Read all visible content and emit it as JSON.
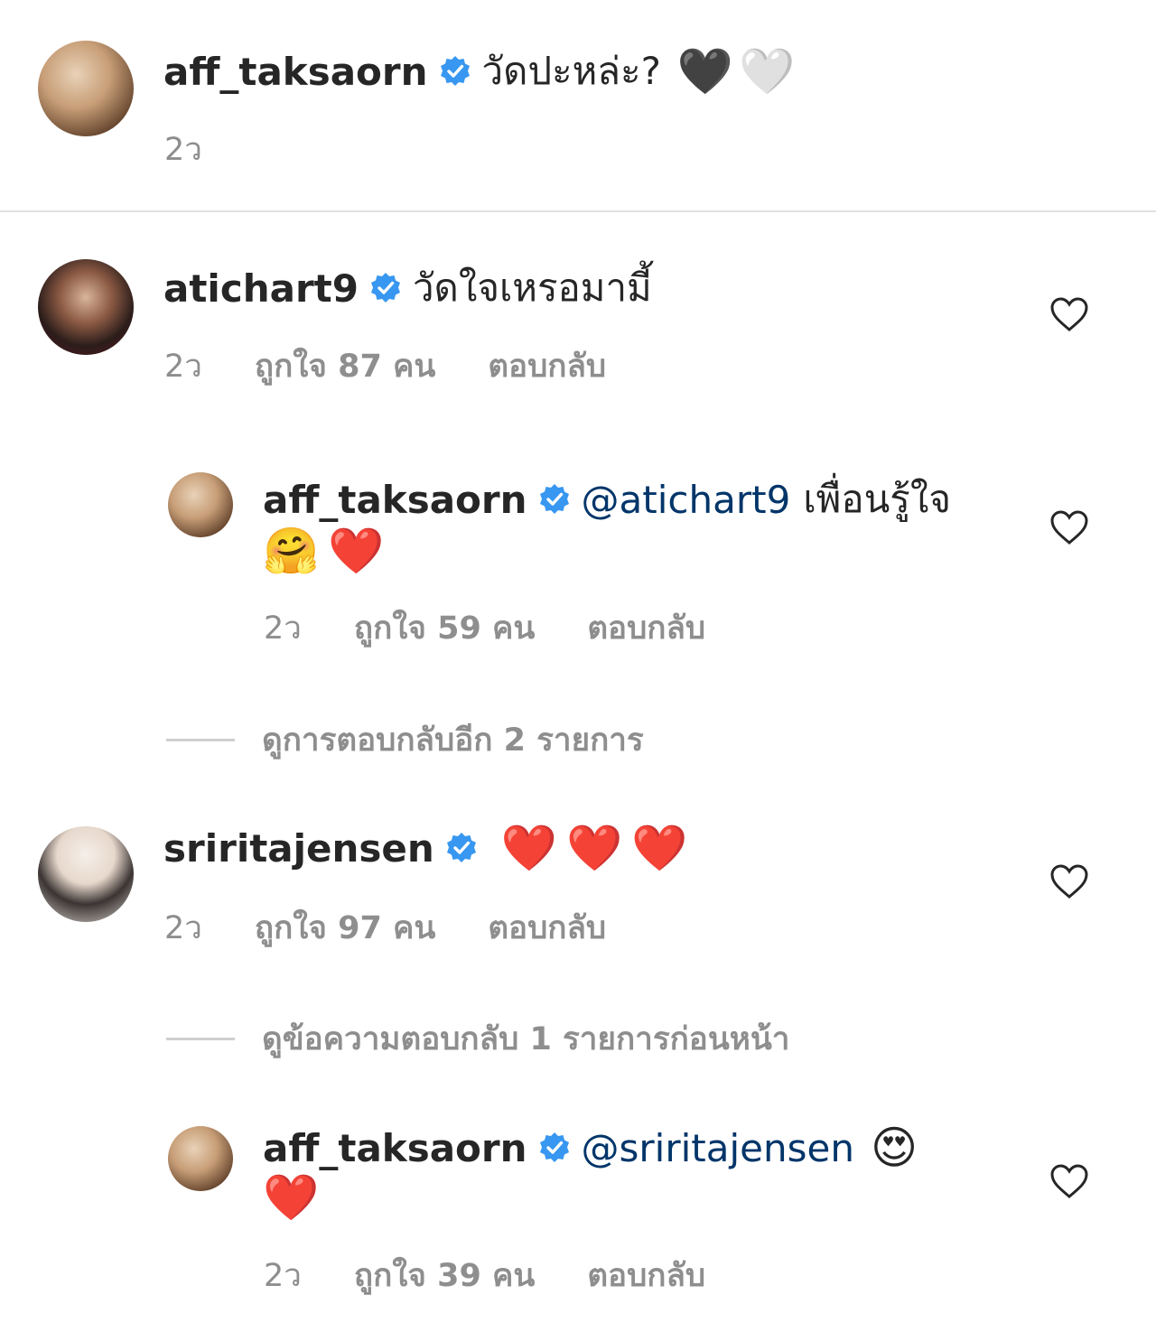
{
  "caption": {
    "username": "aff_taksaorn",
    "text": "วัดปะหล่ะ?",
    "emojis": [
      "🖤",
      "🤍"
    ],
    "time": "2ว"
  },
  "comments": [
    {
      "username": "atichart9",
      "text": "วัดใจเหรอมามี้",
      "time": "2ว",
      "likes": "ถูกใจ 87 คน",
      "reply": "ตอบกลับ"
    },
    {
      "username": "aff_taksaorn",
      "mention": "@atichart9",
      "text": "เพื่อนรู้ใจ",
      "emojis": [
        "🤗",
        "❤️"
      ],
      "time": "2ว",
      "likes": "ถูกใจ 59 คน",
      "reply": "ตอบกลับ"
    },
    {
      "username": "sriritajensen",
      "emojis": [
        "❤️",
        "❤️",
        "❤️"
      ],
      "time": "2ว",
      "likes": "ถูกใจ 97 คน",
      "reply": "ตอบกลับ"
    },
    {
      "username": "aff_taksaorn",
      "mention": "@sriritajensen",
      "emojis": [
        "😍",
        "❤️"
      ],
      "time": "2ว",
      "likes": "ถูกใจ 39 คน",
      "reply": "ตอบกลับ"
    }
  ],
  "view_more_replies": "ดูการตอบกลับอีก 2 รายการ",
  "view_previous_replies": "ดูข้อความตอบกลับ 1 รายการก่อนหน้า",
  "colors": {
    "verified": "#3897f0",
    "mention": "#003569",
    "meta": "#8e8e8e"
  }
}
